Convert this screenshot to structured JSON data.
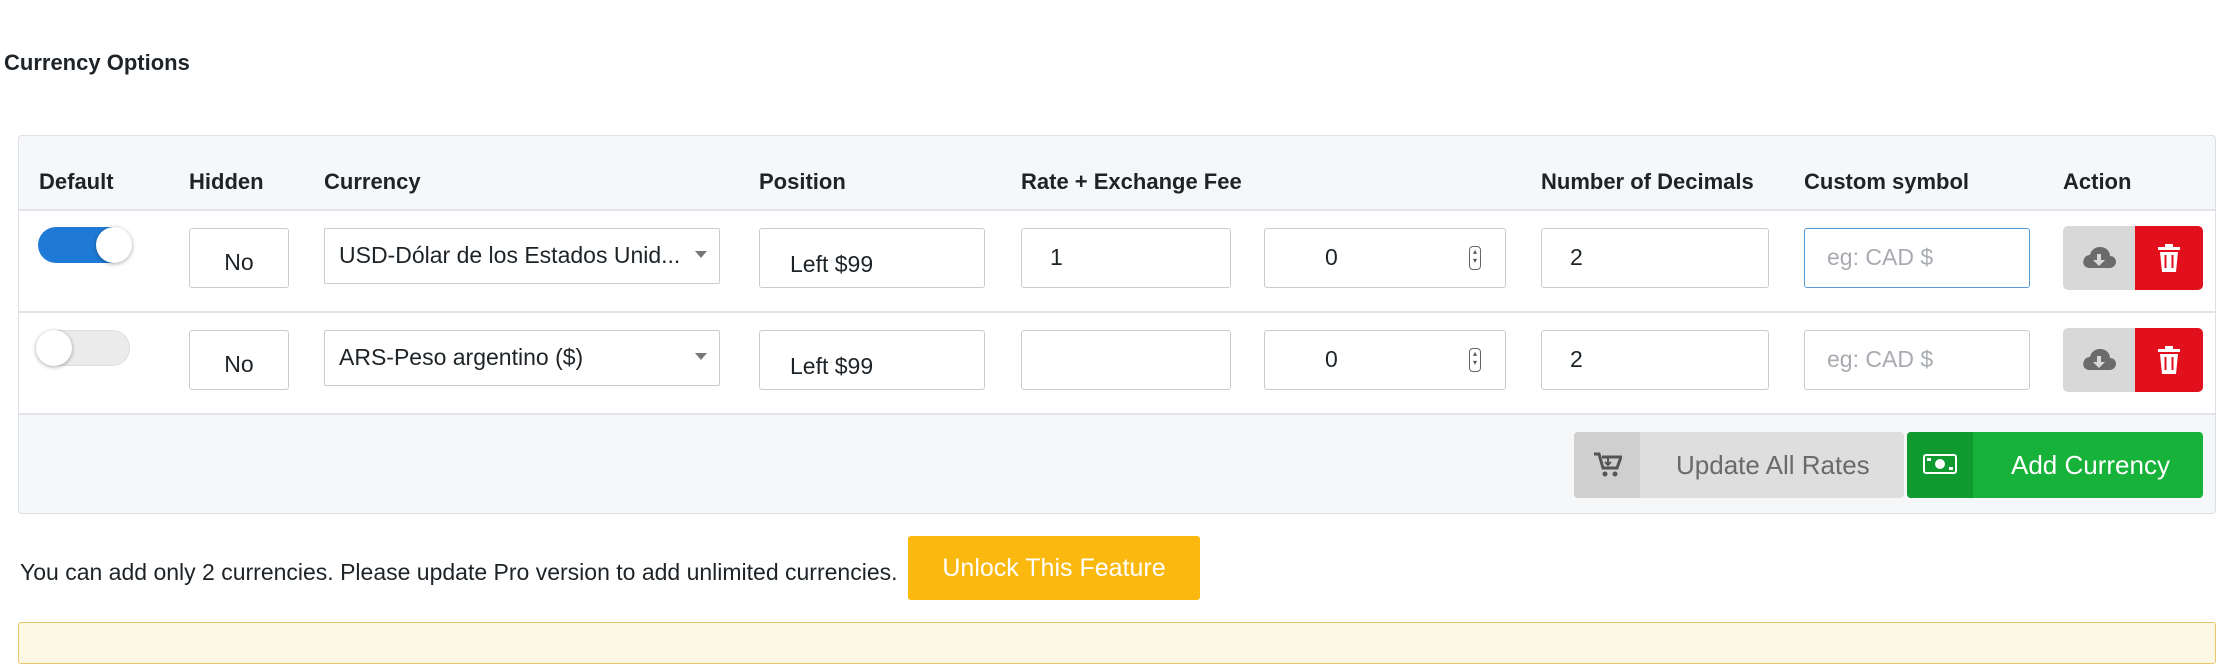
{
  "section_title": "Currency Options",
  "table": {
    "headers": {
      "default": "Default",
      "hidden": "Hidden",
      "currency": "Currency",
      "position": "Position",
      "rate": "Rate + Exchange Fee",
      "decimals": "Number of Decimals",
      "custom_symbol": "Custom symbol",
      "action": "Action"
    },
    "rows": [
      {
        "default_on": true,
        "hidden": "No",
        "currency": "USD-Dólar de los Estados Unid...",
        "position": "Left $99",
        "rate": "1",
        "fee": "0",
        "decimals": "2",
        "symbol_placeholder": "eg: CAD $"
      },
      {
        "default_on": false,
        "hidden": "No",
        "currency": "ARS-Peso argentino ($)",
        "position": "Left $99",
        "rate": "",
        "fee": "0",
        "decimals": "2",
        "symbol_placeholder": "eg: CAD $"
      }
    ]
  },
  "buttons": {
    "update_all_rates": "Update All Rates",
    "add_currency": "Add Currency",
    "unlock": "Unlock This Feature"
  },
  "notice": "You can add only 2 currencies. Please update Pro version to add unlimited currencies.",
  "colors": {
    "toggle_on": "#1f7ad6",
    "delete_red": "#e2101d",
    "add_green": "#16b23a",
    "unlock_orange": "#fbb80f",
    "focus_border": "#5b9bd5"
  },
  "icons": [
    "cart-icon",
    "money-icon",
    "cloud-download-icon",
    "trash-icon"
  ]
}
